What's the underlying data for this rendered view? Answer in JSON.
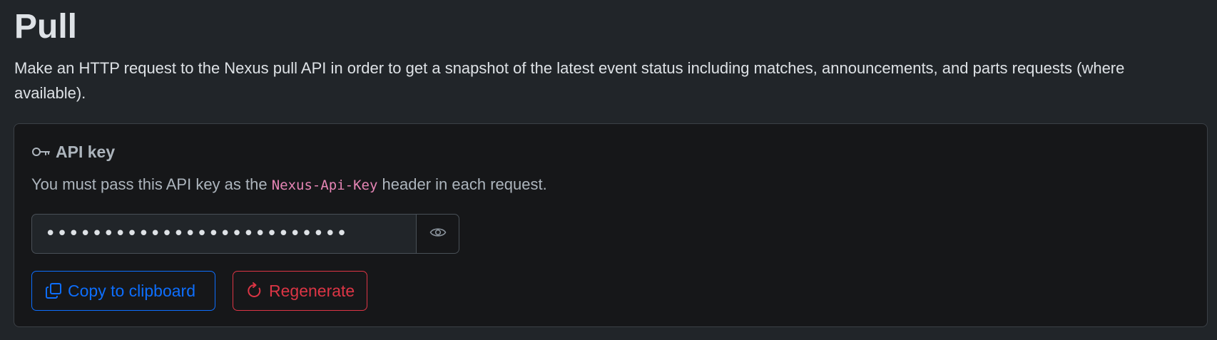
{
  "header": {
    "title": "Pull",
    "description": "Make an HTTP request to the Nexus pull API in order to get a snapshot of the latest event status including matches, announcements, and parts requests (where available)."
  },
  "api_key_card": {
    "icon": "key-icon",
    "title": "API key",
    "text_before": "You must pass this API key as the ",
    "header_name": "Nexus-Api-Key",
    "text_after": " header in each request.",
    "masked_value": "••••••••••••••••••••••••••",
    "toggle_icon": "eye-icon"
  },
  "actions": {
    "copy_label": "Copy to clipboard",
    "copy_icon": "copy-icon",
    "regenerate_label": "Regenerate",
    "regenerate_icon": "refresh-icon"
  },
  "colors": {
    "background": "#212529",
    "card_background": "#161719",
    "primary": "#0d6efd",
    "danger": "#dc3545",
    "code": "#e685b5"
  }
}
